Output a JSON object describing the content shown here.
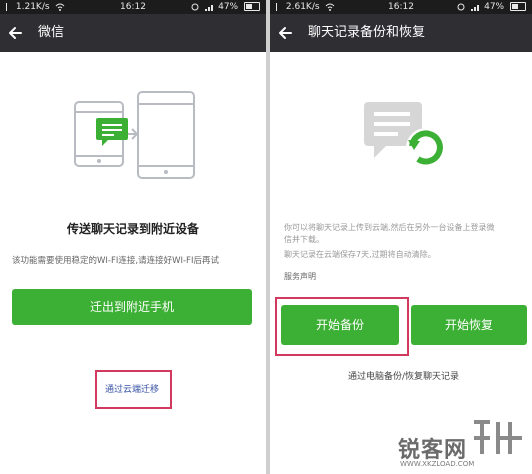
{
  "left": {
    "status": {
      "speed": "1.21K/s",
      "time": "16:12",
      "battery": "47%"
    },
    "title": "微信",
    "heading": "传送聊天记录到附近设备",
    "hint": "该功能需要使用稳定的WI-FI连接,请连接好WI-FI后再试",
    "migrate_button": "迁出到附近手机",
    "cloud_link": "通过云端迁移"
  },
  "right": {
    "status": {
      "speed": "2.61K/s",
      "time": "16:12",
      "battery": "47%"
    },
    "title": "聊天记录备份和恢复",
    "desc_line1": "你可以将聊天记录上传到云端,然后在另外一台设备上登录微",
    "desc_line2": "信并下载。",
    "desc_line3": "聊天记录在云端保存7天,过期将自动清除。",
    "service_link": "服务声明",
    "backup_button": "开始备份",
    "restore_button": "开始恢复",
    "pc_link": "通过电脑备份/恢复聊天记录"
  },
  "watermark": {
    "text": "锐客网",
    "url": "WWW.XKZLOAD.COM"
  }
}
